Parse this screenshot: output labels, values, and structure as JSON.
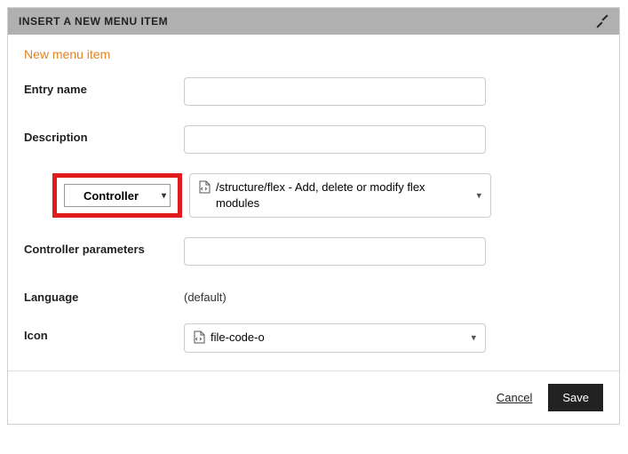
{
  "header": {
    "title": "Insert a new menu item"
  },
  "subtitle": "New menu item",
  "form": {
    "entry_name": {
      "label": "Entry name",
      "value": ""
    },
    "description": {
      "label": "Description",
      "value": ""
    },
    "type_selector": {
      "value": "Controller"
    },
    "controller_combo": {
      "value": "/structure/flex - Add, delete or modify flex modules"
    },
    "controller_params": {
      "label": "Controller parameters",
      "value": ""
    },
    "language": {
      "label": "Language",
      "value": "(default)"
    },
    "icon": {
      "label": "Icon",
      "value": "file-code-o"
    }
  },
  "footer": {
    "cancel": "Cancel",
    "save": "Save"
  }
}
